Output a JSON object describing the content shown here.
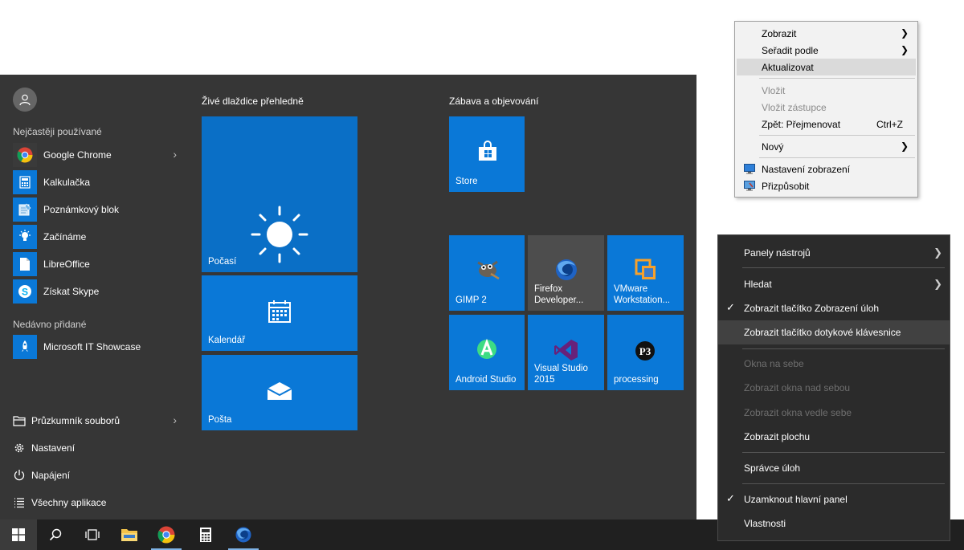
{
  "start_menu": {
    "most_used_label": "Nejčastěji používané",
    "most_used": [
      {
        "label": "Google Chrome"
      },
      {
        "label": "Kalkulačka"
      },
      {
        "label": "Poznámkový blok"
      },
      {
        "label": "Začínáme"
      },
      {
        "label": "LibreOffice"
      },
      {
        "label": "Získat Skype"
      }
    ],
    "recent_label": "Nedávno přidané",
    "recent": [
      {
        "label": "Microsoft IT Showcase"
      }
    ],
    "system": [
      {
        "label": "Průzkumník souborů"
      },
      {
        "label": "Nastavení"
      },
      {
        "label": "Napájení"
      },
      {
        "label": "Všechny aplikace"
      }
    ],
    "group1_title": "Živé dlaždice přehledně",
    "group2_title": "Zábava a objevování",
    "tiles": {
      "weather": "Počasí",
      "calendar": "Kalendář",
      "mail": "Pošta",
      "store": "Store",
      "gimp": "GIMP 2",
      "firefox_line1": "Firefox",
      "firefox_line2": "Developer...",
      "vmware_line1": "VMware",
      "vmware_line2": "Workstation...",
      "android": "Android Studio",
      "vs_line1": "Visual Studio",
      "vs_line2": "2015",
      "processing": "processing"
    }
  },
  "desktop_menu": {
    "items": [
      {
        "label": "Zobrazit",
        "submenu": true
      },
      {
        "label": "Seřadit podle",
        "submenu": true
      },
      {
        "label": "Aktualizovat"
      },
      {
        "label": "Vložit",
        "disabled": true
      },
      {
        "label": "Vložit zástupce",
        "disabled": true
      },
      {
        "label": "Zpět: Přejmenovat",
        "shortcut": "Ctrl+Z"
      },
      {
        "label": "Nový",
        "submenu": true
      },
      {
        "label": "Nastavení zobrazení"
      },
      {
        "label": "Přizpůsobit"
      }
    ]
  },
  "taskbar_menu": {
    "items": [
      {
        "label": "Panely nástrojů",
        "submenu": true
      },
      {
        "label": "Hledat",
        "submenu": true
      },
      {
        "label": "Zobrazit tlačítko Zobrazení úloh",
        "checked": true
      },
      {
        "label": "Zobrazit tlačítko dotykové klávesnice"
      },
      {
        "label": "Okna na sebe",
        "disabled": true
      },
      {
        "label": "Zobrazit okna nad sebou",
        "disabled": true
      },
      {
        "label": "Zobrazit okna vedle sebe",
        "disabled": true
      },
      {
        "label": "Zobrazit plochu"
      },
      {
        "label": "Správce úloh"
      },
      {
        "label": "Uzamknout hlavní panel",
        "checked": true
      },
      {
        "label": "Vlastnosti"
      }
    ]
  },
  "colors": {
    "tile_blue": "#0a78d7",
    "start_bg": "#363636",
    "taskbar_bg": "#202020"
  }
}
